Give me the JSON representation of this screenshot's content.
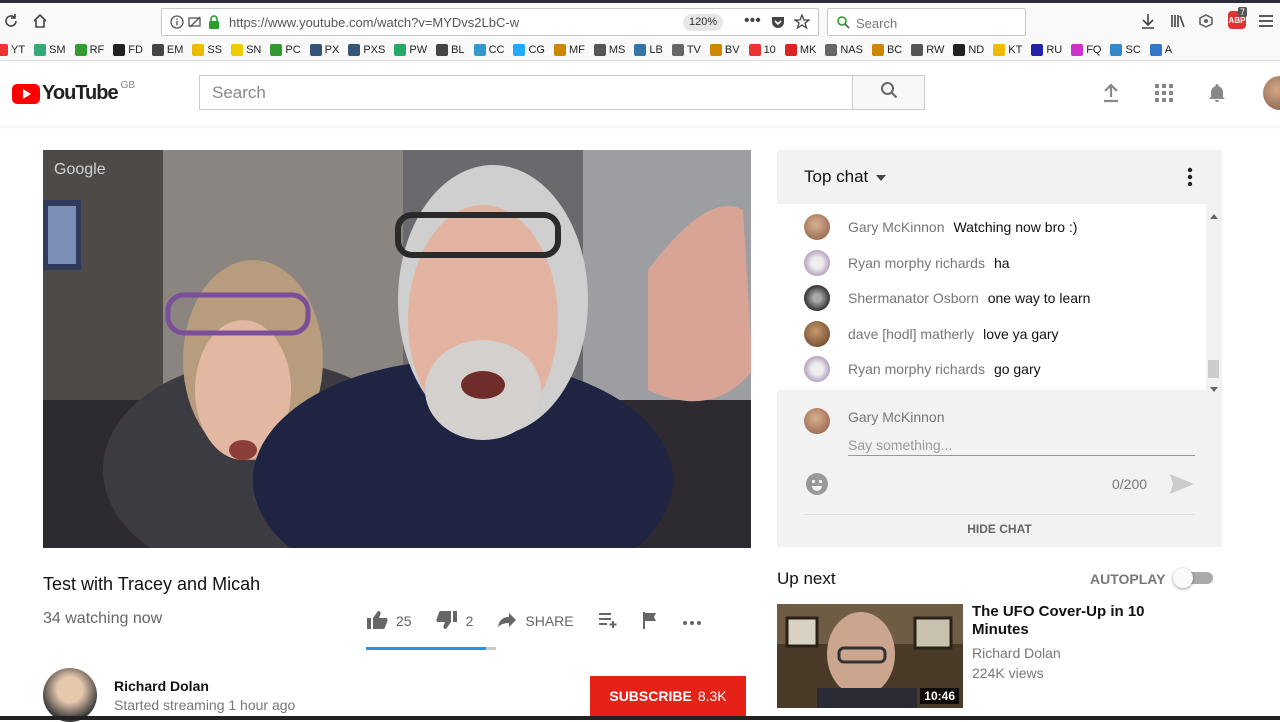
{
  "browser": {
    "url": "https://www.youtube.com/watch?v=MYDvs2LbC-w",
    "zoom": "120%",
    "search_placeholder": "Search",
    "badge_count": "7",
    "bookmarks": [
      "YT",
      "SM",
      "RF",
      "FD",
      "EM",
      "SS",
      "SN",
      "PC",
      "PX",
      "PXS",
      "PW",
      "BL",
      "CC",
      "CG",
      "MF",
      "MS",
      "LB",
      "TV",
      "BV",
      "10",
      "MK",
      "NAS",
      "BC",
      "RW",
      "ND",
      "KT",
      "RU",
      "FQ",
      "SC",
      "A"
    ],
    "bookmark_colors": [
      "#e33",
      "#3a7",
      "#393",
      "#222",
      "#444",
      "#eb0",
      "#ec0",
      "#393",
      "#357",
      "#357",
      "#2a6",
      "#444",
      "#39c",
      "#2af",
      "#c80",
      "#555",
      "#37a",
      "#666",
      "#c80",
      "#e33",
      "#d22",
      "#666",
      "#c80",
      "#555",
      "#222",
      "#eb0",
      "#22a",
      "#c3c",
      "#38c",
      "#37c"
    ]
  },
  "header": {
    "logo": "YouTube",
    "region": "GB",
    "search_placeholder": "Search"
  },
  "video": {
    "overlay_brand": "Google",
    "title": "Test with Tracey and Micah",
    "watching": "34 watching now",
    "likes": "25",
    "dislikes": "2",
    "share_label": "SHARE",
    "like_ratio": 0.926
  },
  "channel": {
    "name": "Richard Dolan",
    "status": "Started streaming 1 hour ago",
    "subscribe_label": "SUBSCRIBE",
    "subscriber_count": "8.3K"
  },
  "chat": {
    "title": "Top chat",
    "messages": [
      {
        "author": "Gary McKinnon",
        "text": "Watching now bro :)"
      },
      {
        "author": "Ryan morphy richards",
        "text": "ha"
      },
      {
        "author": "Shermanator Osborn",
        "text": "one way to learn"
      },
      {
        "author": "dave [hodl] matherly",
        "text": "love ya gary"
      },
      {
        "author": "Ryan morphy richards",
        "text": "go gary"
      }
    ],
    "compose_name": "Gary McKinnon",
    "compose_placeholder": "Say something...",
    "char_count": "0/200",
    "hide_label": "HIDE CHAT"
  },
  "upnext": {
    "label": "Up next",
    "autoplay_label": "AUTOPLAY",
    "autoplay_on": false,
    "title": "The UFO Cover-Up in 10 Minutes",
    "channel": "Richard Dolan",
    "views": "224K views",
    "duration": "10:46"
  }
}
